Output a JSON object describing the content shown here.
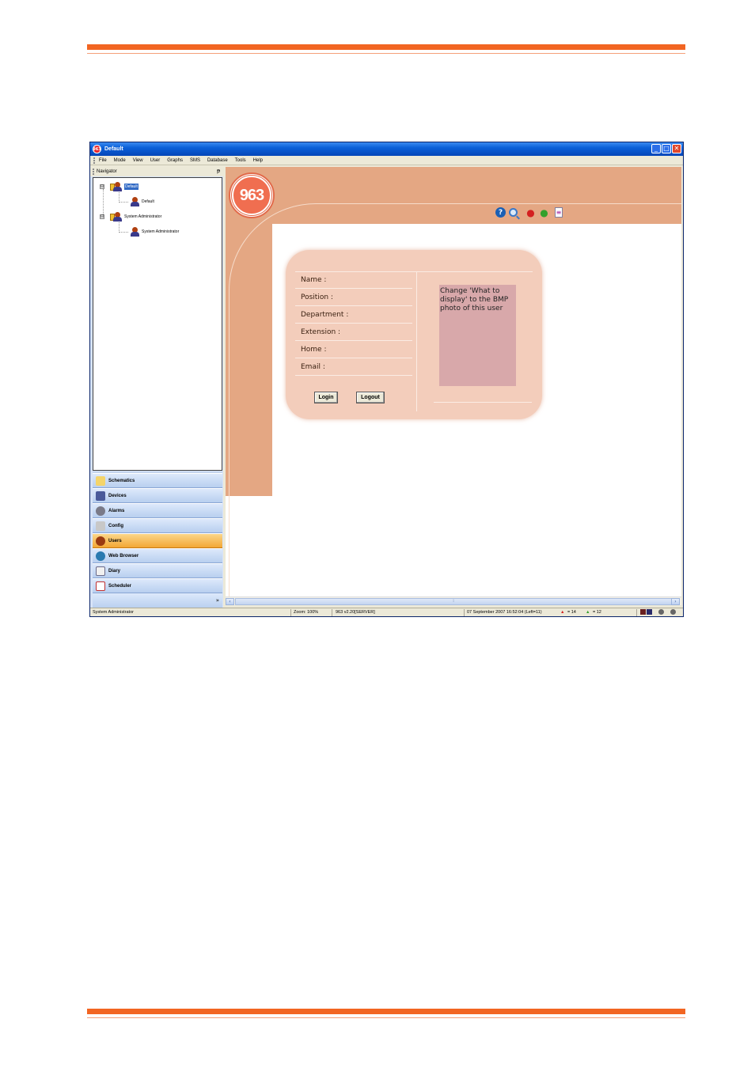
{
  "window": {
    "title": "Default",
    "app_icon_text": "963",
    "controls": {
      "minimize": "_",
      "maximize": "□",
      "close": "✕"
    }
  },
  "menu": [
    "File",
    "Mode",
    "View",
    "User",
    "Graphs",
    "SMS",
    "Database",
    "Tools",
    "Help"
  ],
  "navigator": {
    "title": "Navigator",
    "pin": "ᵽ",
    "tree": [
      {
        "label": "Default",
        "selected": true,
        "child": "Default"
      },
      {
        "label": "System Administrator",
        "selected": false,
        "child": "System Administrator"
      }
    ],
    "expand_symbol": "⊟"
  },
  "outlook_bar": {
    "items": [
      "Schematics",
      "Devices",
      "Alarms",
      "Config",
      "Users",
      "Web Browser",
      "Diary",
      "Scheduler"
    ],
    "active": "Users",
    "footer_symbol": "»"
  },
  "content": {
    "logo_text": "963",
    "toolbar": {
      "help": "?",
      "search": "",
      "alarm_red": "●",
      "alarm_green": "●",
      "doc": "≡"
    },
    "fields": [
      "Name  :",
      "Position  :",
      "Department  :",
      "Extension  :",
      "Home  :",
      "Email  :"
    ],
    "photo_text": "Change 'What to display' to the BMP photo of this user",
    "buttons": {
      "login": "Login",
      "logout": "Logout"
    }
  },
  "scrollbar": {
    "left": "‹",
    "right": "›",
    "thumb": "⁞"
  },
  "status": {
    "user": "System Administrator",
    "zoom": "Zoom: 100%",
    "version": "963 v2.20[SERVER]",
    "datetime": "07 September 2007 16:52:04 (Left=11)",
    "red_count": "= 14",
    "green_count": "= 12"
  },
  "colors": {
    "accent_orange": "#f26522",
    "band": "#e4a783",
    "card": "#f3cdbb",
    "photo": "#d8a8aa"
  }
}
